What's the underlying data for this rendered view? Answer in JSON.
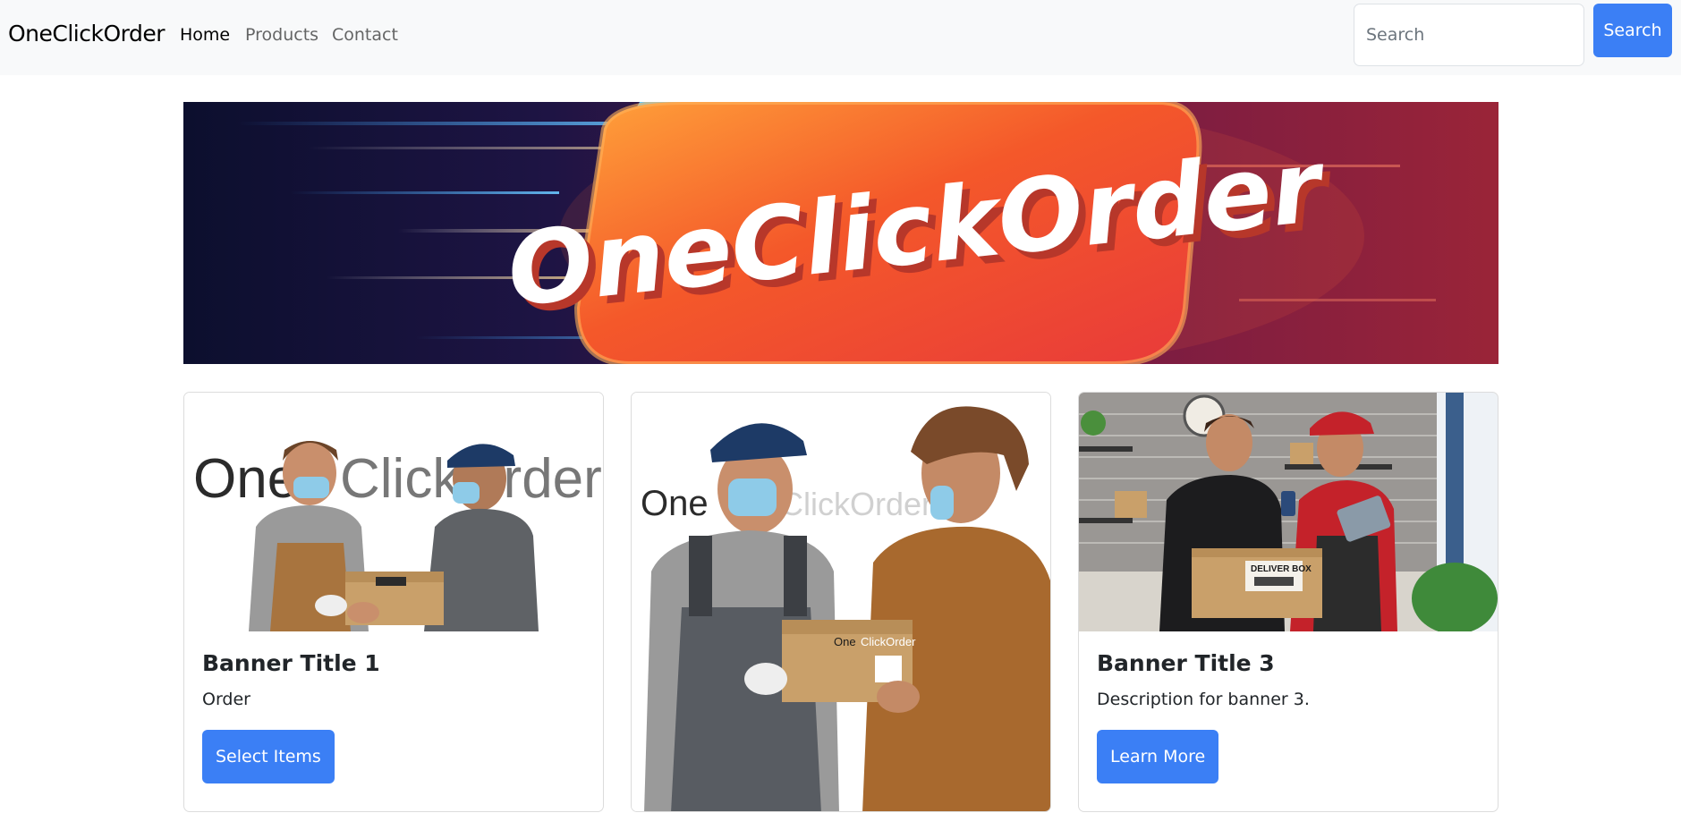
{
  "navbar": {
    "brand": "OneClickOrder",
    "links": [
      {
        "label": "Home",
        "active": true
      },
      {
        "label": "Products",
        "active": false
      },
      {
        "label": "Contact",
        "active": false
      }
    ],
    "search": {
      "placeholder": "Search",
      "value": "",
      "button_label": "Search"
    }
  },
  "hero": {
    "logo_text": "OneClickOrder"
  },
  "cards": [
    {
      "title": "Banner Title 1",
      "text": "Order",
      "button_label": "Select Items",
      "image_watermark_a": "One",
      "image_watermark_b": "ClickOrder"
    },
    {
      "title": "",
      "text": "",
      "button_label": "",
      "image_watermark_a": "One",
      "image_watermark_b": "ClickOrder",
      "box_label_a": "One",
      "box_label_b": "ClickOrder"
    },
    {
      "title": "Banner Title 3",
      "text": "Description for banner 3.",
      "button_label": "Learn More",
      "box_label": "DELIVER BOX"
    }
  ],
  "colors": {
    "primary": "#3b7ff5",
    "navbar_bg": "#f8f9fa",
    "hero_badge": "#f2542a",
    "hero_bg_dark": "#0c0f2e",
    "hero_bg_red": "#9a2438"
  }
}
